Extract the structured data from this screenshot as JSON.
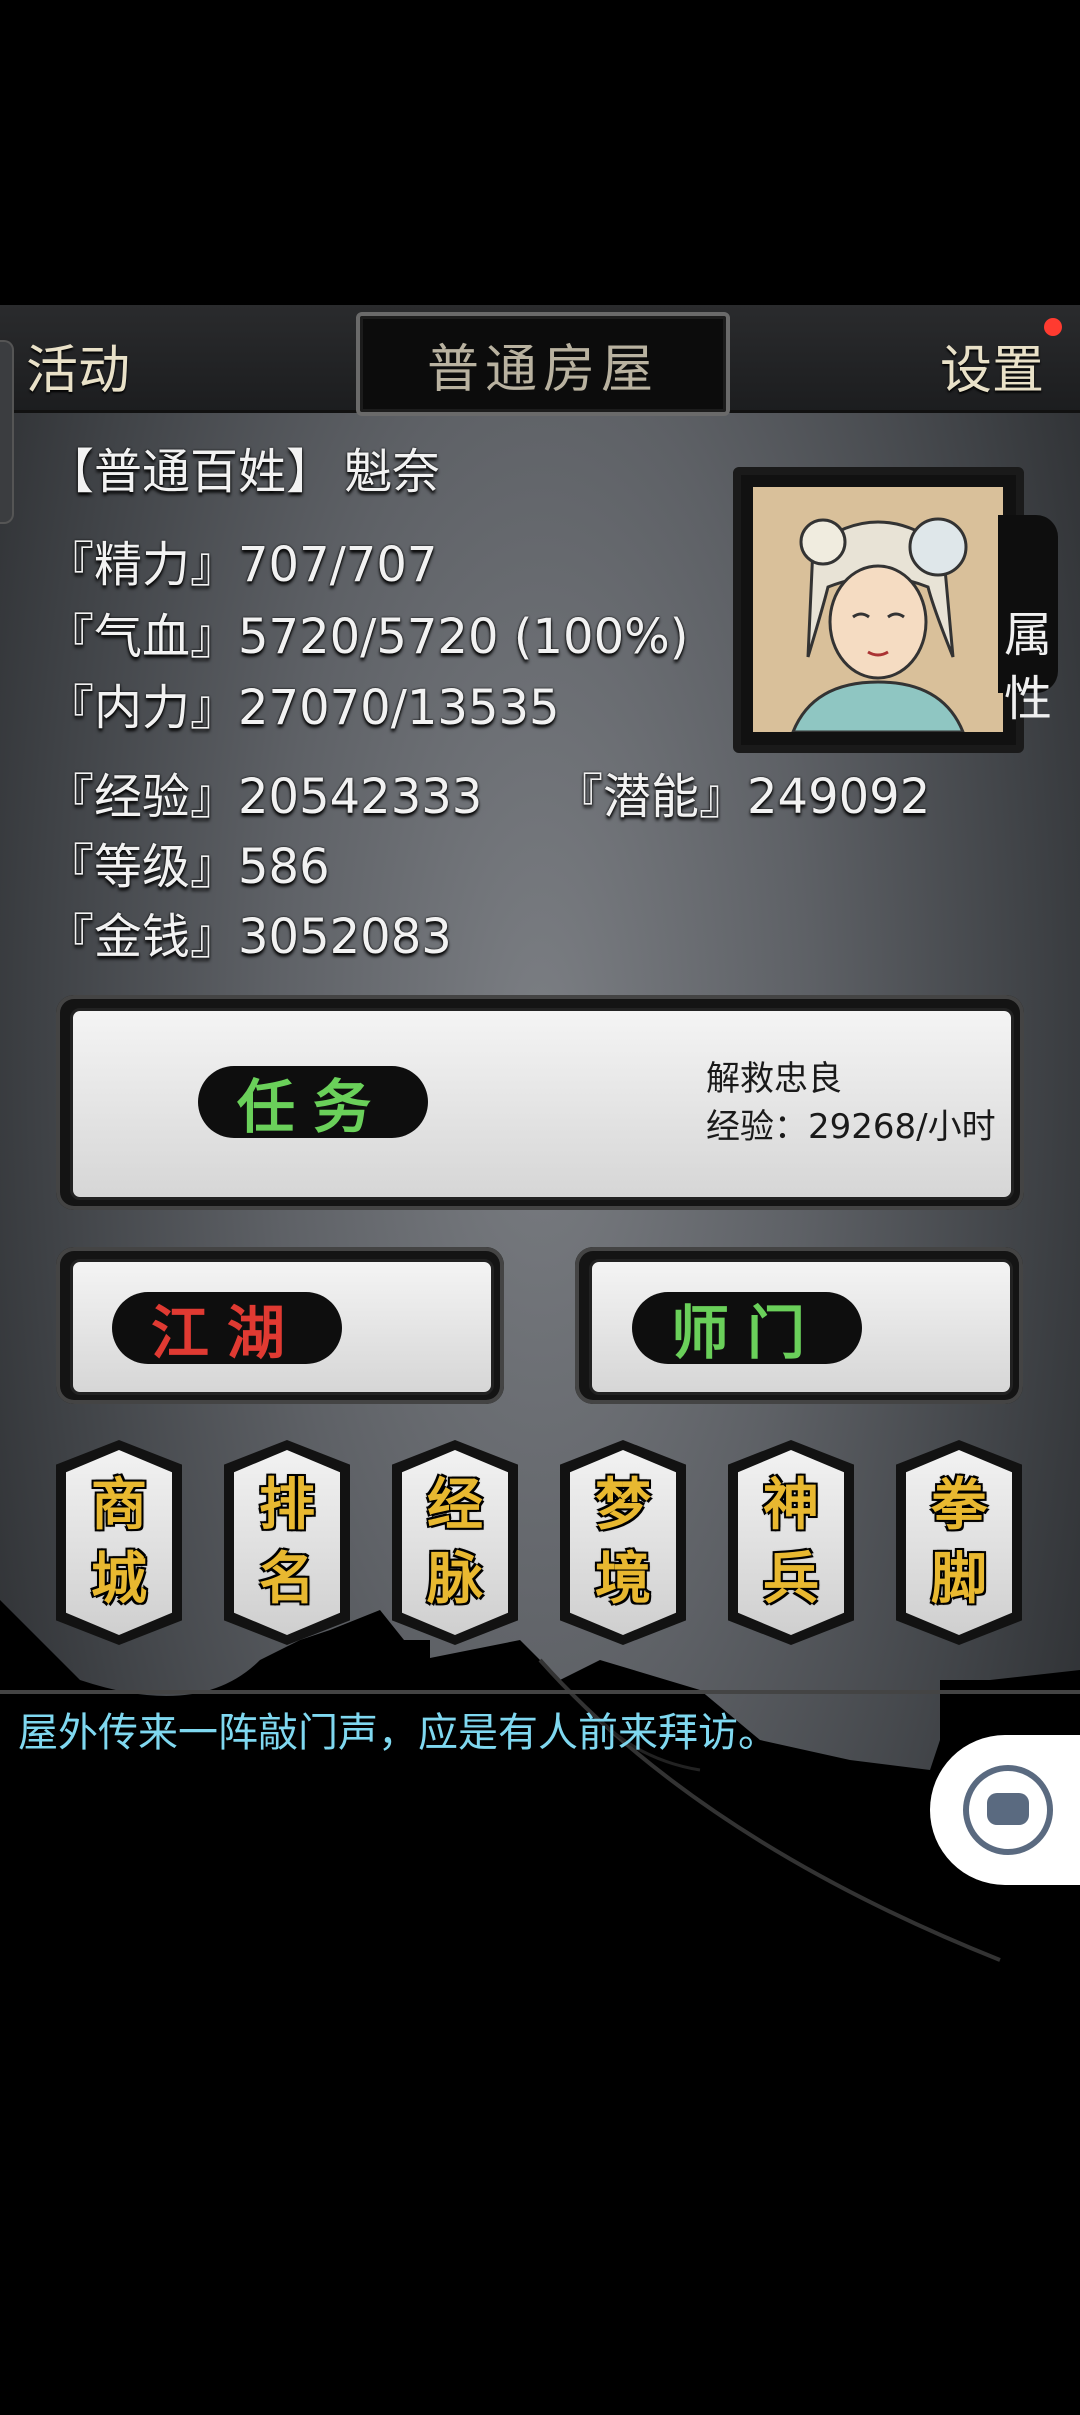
{
  "header": {
    "left_label": "活动",
    "title": "普通房屋",
    "right_label": "设置"
  },
  "profile": {
    "rank": "【普通百姓】",
    "name": "魁奈",
    "stats": [
      {
        "label": "『精力』",
        "value": "707/707"
      },
      {
        "label": "『气血』",
        "value": "5720/5720 (100%)"
      },
      {
        "label": "『内力』",
        "value": "27070/13535"
      }
    ],
    "experience": {
      "label": "『经验』",
      "value": "20542333"
    },
    "potential": {
      "label": "『潜能』",
      "value": "249092"
    },
    "level": {
      "label": "『等级』",
      "value": "586"
    },
    "money": {
      "label": "『金钱』",
      "value": "3052083"
    },
    "attribute_tab": "属\n性"
  },
  "task": {
    "label": "任务",
    "name": "解救忠良",
    "exp_rate": "经验：29268/小时"
  },
  "buttons": {
    "jianghu": "江湖",
    "shimen": "师门"
  },
  "menu": [
    "商\n城",
    "排\n名",
    "经\n脉",
    "梦\n境",
    "神\n兵",
    "拳\n脚"
  ],
  "message": "屋外传来一阵敲门声，应是有人前来拜访。",
  "colors": {
    "task_label": "#6ad05a",
    "jianghu_label": "#e03a32",
    "menu_label": "#e8b830",
    "message": "#7fd8f0",
    "notification_dot": "#ff3b30"
  },
  "icons": {
    "notification": "red-dot-icon",
    "assistant": "robot-assistant-icon"
  }
}
